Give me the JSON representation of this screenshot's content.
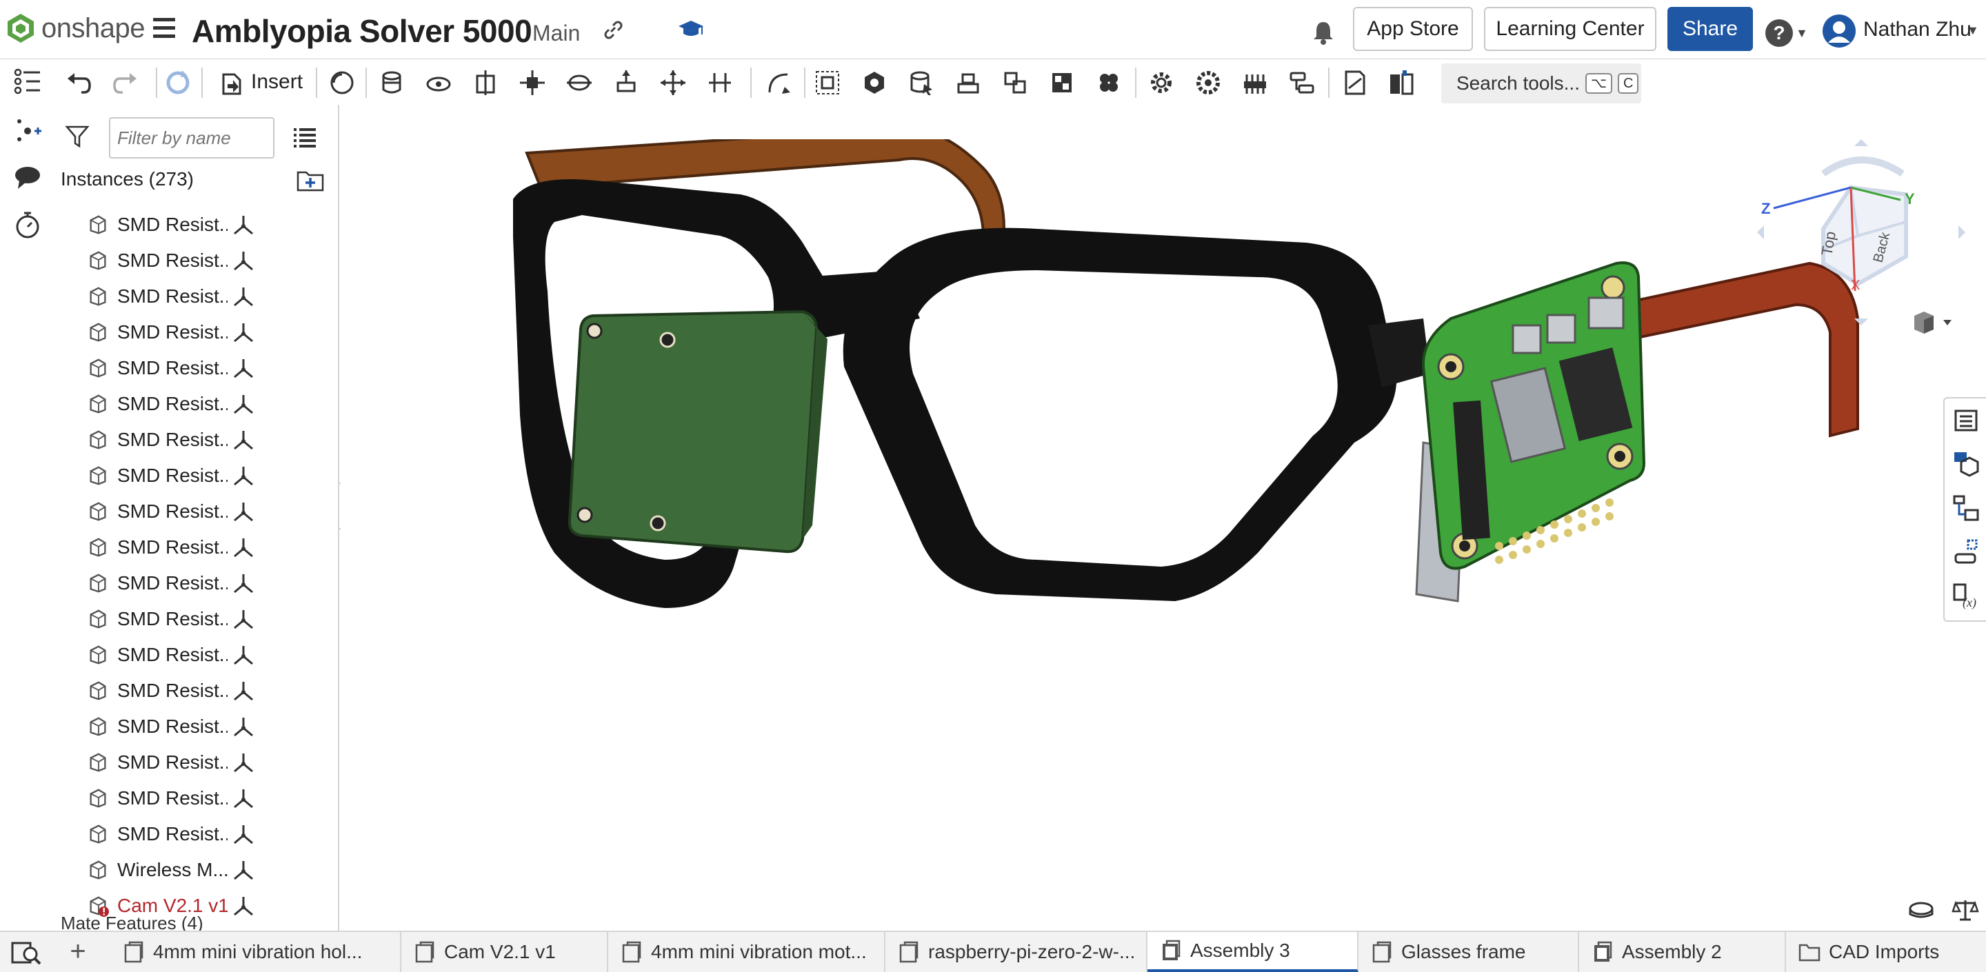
{
  "header": {
    "brand": "onshape",
    "document_title": "Amblyopia Solver 5000",
    "branch": "Main",
    "buttons": {
      "app_store": "App Store",
      "learning_center": "Learning Center",
      "share": "Share"
    },
    "help": "?",
    "user_name": "Nathan Zhu"
  },
  "toolbar": {
    "insert_label": "Insert",
    "search_tools": "Search tools...",
    "search_shortcut": [
      "⌥",
      "C"
    ]
  },
  "panel": {
    "filter_placeholder": "Filter by name",
    "instances_label": "Instances (273)",
    "instances": [
      "SMD Resist...",
      "SMD Resist...",
      "SMD Resist...",
      "SMD Resist...",
      "SMD Resist...",
      "SMD Resist...",
      "SMD Resist...",
      "SMD Resist...",
      "SMD Resist...",
      "SMD Resist...",
      "SMD Resist...",
      "SMD Resist...",
      "SMD Resist...",
      "SMD Resist...",
      "SMD Resist...",
      "SMD Resist...",
      "SMD Resist...",
      "SMD Resist...",
      "Wireless M...",
      "Cam V2.1 v1..."
    ],
    "error_instance": "Cam V2.1 v1...",
    "mate_features_label": "Mate Features (4)"
  },
  "viewcube": {
    "faces": [
      "Top",
      "Back"
    ],
    "axes": [
      "Z",
      "Y",
      "X"
    ]
  },
  "tabs": [
    {
      "label": "4mm mini vibration hol...",
      "icon": "part-studio-icon",
      "active": false
    },
    {
      "label": "Cam V2.1 v1",
      "icon": "part-studio-icon",
      "active": false
    },
    {
      "label": "4mm mini vibration mot...",
      "icon": "part-studio-icon",
      "active": false
    },
    {
      "label": "raspberry-pi-zero-2-w-...",
      "icon": "part-studio-icon",
      "active": false
    },
    {
      "label": "Assembly 3",
      "icon": "assembly-icon",
      "active": true
    },
    {
      "label": "Glasses frame",
      "icon": "part-studio-icon",
      "active": false
    },
    {
      "label": "Assembly 2",
      "icon": "assembly-icon",
      "active": false
    },
    {
      "label": "CAD Imports",
      "icon": "folder-icon",
      "active": false
    }
  ],
  "colors": {
    "share_blue": "#1f57a4",
    "pcb_green": "#3fa43a",
    "camera_board_green": "#3e6b3a",
    "frame_black": "#111111",
    "temple_brown": "#8a4a1c",
    "temple_red_brown": "#a03a1e",
    "error_red": "#b3262b"
  }
}
